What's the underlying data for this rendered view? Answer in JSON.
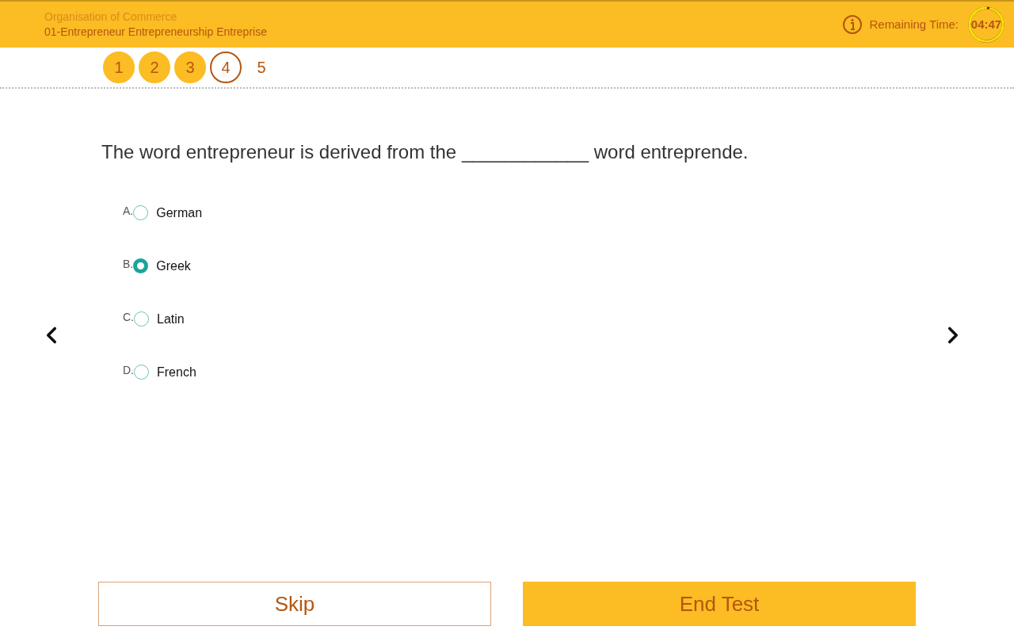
{
  "header": {
    "organisation": "Organisation of Commerce",
    "subject": "01-Entrepreneur Entrepreneurship Entreprise",
    "remaining_label": "Remaining Time:",
    "timer": {
      "text": "04:47",
      "level": 0.97
    }
  },
  "steps": [
    {
      "label": "1",
      "answered": true,
      "selected": false
    },
    {
      "label": "2",
      "answered": true,
      "selected": false
    },
    {
      "label": "3",
      "answered": true,
      "selected": false
    },
    {
      "label": "4",
      "answered": false,
      "selected": true
    },
    {
      "label": "5",
      "answered": false,
      "selected": false
    }
  ],
  "question": "The word entrepreneur is derived from the ____________ word entreprende.",
  "options": [
    {
      "letter": "A.",
      "text": "German",
      "selected": false
    },
    {
      "letter": "B.",
      "text": "Greek",
      "selected": true
    },
    {
      "letter": "C.",
      "text": "Latin",
      "selected": false
    },
    {
      "letter": "D.",
      "text": "French",
      "selected": false
    }
  ],
  "buttons": {
    "skip": "Skip",
    "end": "End Test"
  }
}
